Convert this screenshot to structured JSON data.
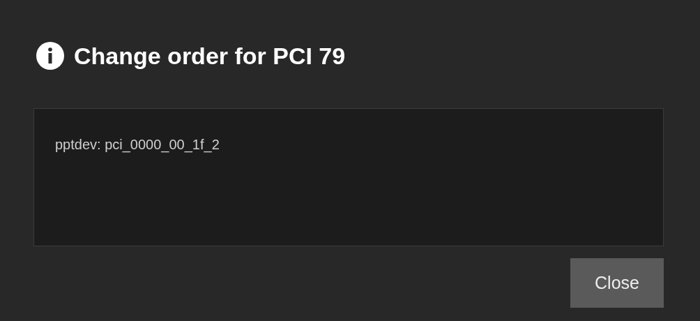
{
  "dialog": {
    "title": "Change order for PCI 79",
    "content": "pptdev: pci_0000_00_1f_2",
    "buttons": [
      "Close"
    ]
  }
}
